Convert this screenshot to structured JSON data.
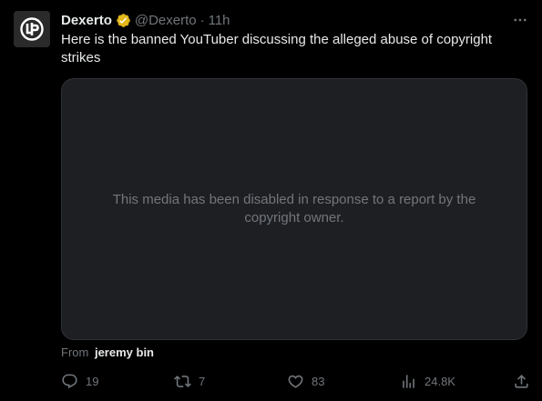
{
  "author": {
    "display_name": "Dexerto",
    "handle": "@Dexerto",
    "separator": "·",
    "timestamp": "11h",
    "verified_color": "#e2b719",
    "avatar_logo": "dexerto-logo-icon"
  },
  "tweet": {
    "text": "Here is the banned YouTuber discussing the alleged abuse of copyright strikes"
  },
  "media": {
    "message": "This media has been disabled in response to a report by the copyright owner."
  },
  "attribution": {
    "label": "From",
    "name": "jeremy bin"
  },
  "actions": {
    "reply_count": "19",
    "retweet_count": "7",
    "like_count": "83",
    "views_count": "24.8K"
  },
  "icons": {
    "more": "more-horizontal-icon",
    "reply": "reply-icon",
    "retweet": "retweet-icon",
    "like": "heart-icon",
    "views": "views-icon",
    "share": "share-icon"
  },
  "colors": {
    "background": "#000000",
    "text_primary": "#e7e9ea",
    "text_secondary": "#71767b",
    "media_background": "#1e1f23"
  }
}
